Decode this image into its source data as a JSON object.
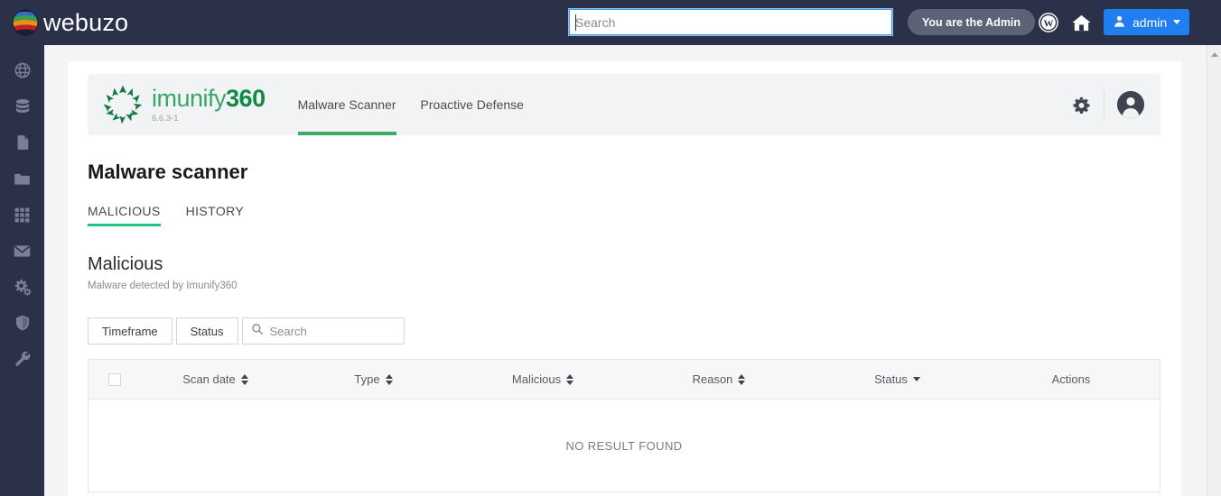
{
  "topbar": {
    "brand_name": "webuzo",
    "brand_logo_icon": "webuzo-globe-logo",
    "search": {
      "value": "",
      "placeholder": "Search"
    },
    "admin_badge": "You are the Admin",
    "wordpress_icon": "wordpress-icon",
    "home_icon": "home-icon",
    "user_icon": "user-icon",
    "admin_label": "admin",
    "caret_icon": "chevron-down-icon",
    "bg_color": "#2b3148",
    "accent_color": "#1f7ff1"
  },
  "sidebar": {
    "items": [
      {
        "icon": "globe-icon",
        "label": "Domains"
      },
      {
        "icon": "database-icon",
        "label": "Databases"
      },
      {
        "icon": "file-icon",
        "label": "Files"
      },
      {
        "icon": "folder-icon",
        "label": "Folders"
      },
      {
        "icon": "grid-icon",
        "label": "Apps"
      },
      {
        "icon": "envelope-icon",
        "label": "Email"
      },
      {
        "icon": "gears-icon",
        "label": "Settings"
      },
      {
        "icon": "shield-icon",
        "label": "Security"
      },
      {
        "icon": "wrench-icon",
        "label": "Tools"
      }
    ]
  },
  "imunify": {
    "logo_icon": "imunify360-star-icon",
    "name_light": "imunify",
    "name_bold": "360",
    "version": "6.6.3-1",
    "tabs": [
      {
        "label": "Malware Scanner",
        "active": true
      },
      {
        "label": "Proactive Defense",
        "active": false
      }
    ],
    "gear_icon": "gear-icon",
    "avatar_icon": "user-avatar-icon",
    "accent_color": "#3aaa67"
  },
  "page": {
    "title": "Malware scanner",
    "tabs": [
      {
        "label": "MALICIOUS",
        "active": true
      },
      {
        "label": "HISTORY",
        "active": false
      }
    ],
    "section_title": "Malicious",
    "section_subtitle": "Malware detected by Imunify360"
  },
  "filters": {
    "timeframe_label": "Timeframe",
    "status_label": "Status",
    "search_icon": "search-icon",
    "search": {
      "value": "",
      "placeholder": "Search"
    }
  },
  "table": {
    "select_all_checked": false,
    "columns": [
      {
        "label": "",
        "sort": "none"
      },
      {
        "label": "Scan date",
        "sort": "both"
      },
      {
        "label": "Type",
        "sort": "both"
      },
      {
        "label": "Malicious",
        "sort": "both"
      },
      {
        "label": "Reason",
        "sort": "both"
      },
      {
        "label": "Status",
        "sort": "down"
      },
      {
        "label": "Actions",
        "sort": "none"
      }
    ],
    "rows": [],
    "empty_message": "NO RESULT FOUND"
  },
  "scrollbar": {
    "arrow_up_icon": "scroll-up-arrow-icon"
  }
}
